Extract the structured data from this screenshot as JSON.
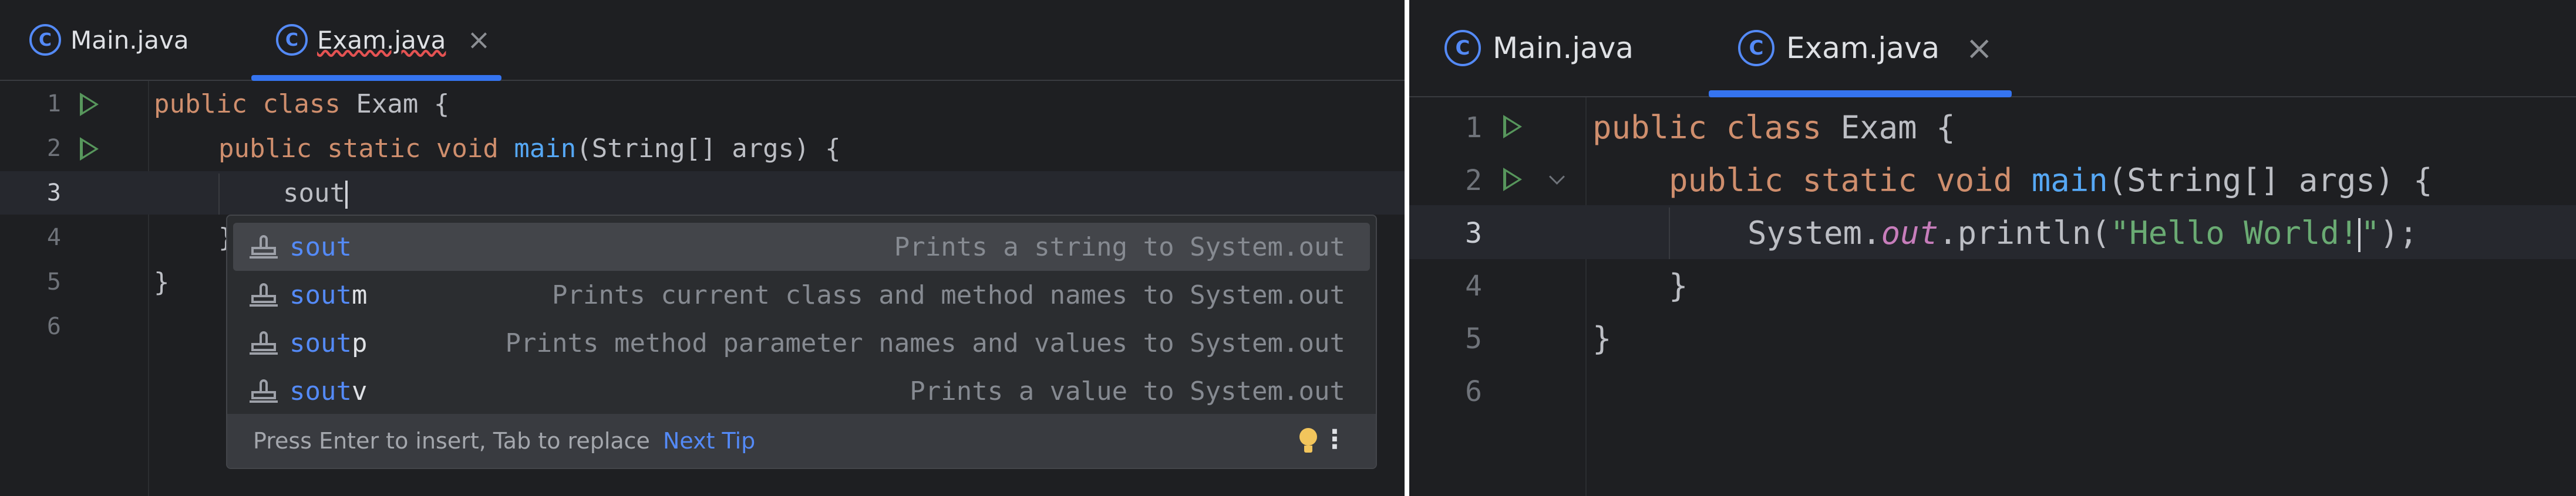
{
  "left": {
    "tabs": [
      {
        "label": "Main.java",
        "icon": "java-class-icon",
        "active": false
      },
      {
        "label": "Exam.java",
        "icon": "java-class-icon",
        "active": true,
        "close": "×"
      }
    ],
    "line_numbers": [
      "1",
      "2",
      "3",
      "4",
      "5",
      "6"
    ],
    "code": {
      "l1_kw": "public class ",
      "l1_rest": "Exam {",
      "l2_kw": "public static void ",
      "l2_fn": "main",
      "l2_rest": "(String[] args) {",
      "l3_typed": "sout",
      "l4_text": "}",
      "l5_text": "}"
    },
    "completion": {
      "items": [
        {
          "match": "sout",
          "rest": "",
          "description": "Prints a string to System.out",
          "selected": true
        },
        {
          "match": "sout",
          "rest": "m",
          "description": "Prints current class and method names to System.out",
          "selected": false
        },
        {
          "match": "sout",
          "rest": "p",
          "description": "Prints method parameter names and values to System.out",
          "selected": false
        },
        {
          "match": "sout",
          "rest": "v",
          "description": "Prints a value to System.out",
          "selected": false
        }
      ],
      "footer_hint": "Press Enter to insert, Tab to replace",
      "footer_link": "Next Tip"
    }
  },
  "right": {
    "tabs": [
      {
        "label": "Main.java",
        "icon": "java-class-icon",
        "active": false
      },
      {
        "label": "Exam.java",
        "icon": "java-class-icon",
        "active": true,
        "close": "×"
      }
    ],
    "line_numbers": [
      "1",
      "2",
      "3",
      "4",
      "5",
      "6"
    ],
    "code": {
      "l1_kw": "public class ",
      "l1_rest": "Exam {",
      "l2_kw": "public static void ",
      "l2_fn": "main",
      "l2_rest": "(String[] args) {",
      "l3_a": "System.",
      "l3_field": "out",
      "l3_b": ".println(",
      "l3_str_a": "\"Hello World!",
      "l3_str_b": "\"",
      "l3_c": ");",
      "l4_text": "}",
      "l5_text": "}"
    }
  },
  "colors": {
    "background": "#1e1f22",
    "keyword": "#cf8e6d",
    "function": "#56a8f5",
    "string": "#6aab73",
    "static_field": "#c77dbb",
    "accent": "#3574f0",
    "run_icon": "#57965c"
  }
}
